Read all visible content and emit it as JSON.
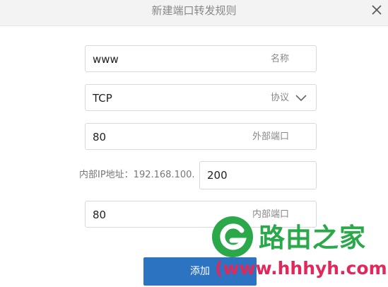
{
  "dialog": {
    "title": "新建端口转发规则"
  },
  "form": {
    "name": {
      "value": "www",
      "label": "名称"
    },
    "protocol": {
      "value": "TCP",
      "label": "协议"
    },
    "external_port": {
      "value": "80",
      "label": "外部端口"
    },
    "internal_ip": {
      "label": "内部IP地址：192.168.100.",
      "value": "200"
    },
    "internal_port": {
      "value": "80",
      "label": "内部端口"
    }
  },
  "actions": {
    "add_label": "添加"
  },
  "watermark": {
    "name": "路由之家",
    "url": "(www.hhhyh.com)"
  },
  "colors": {
    "primary": "#2c74c2",
    "watermark_green": "#2aa84a",
    "watermark_red": "#e0285a"
  }
}
